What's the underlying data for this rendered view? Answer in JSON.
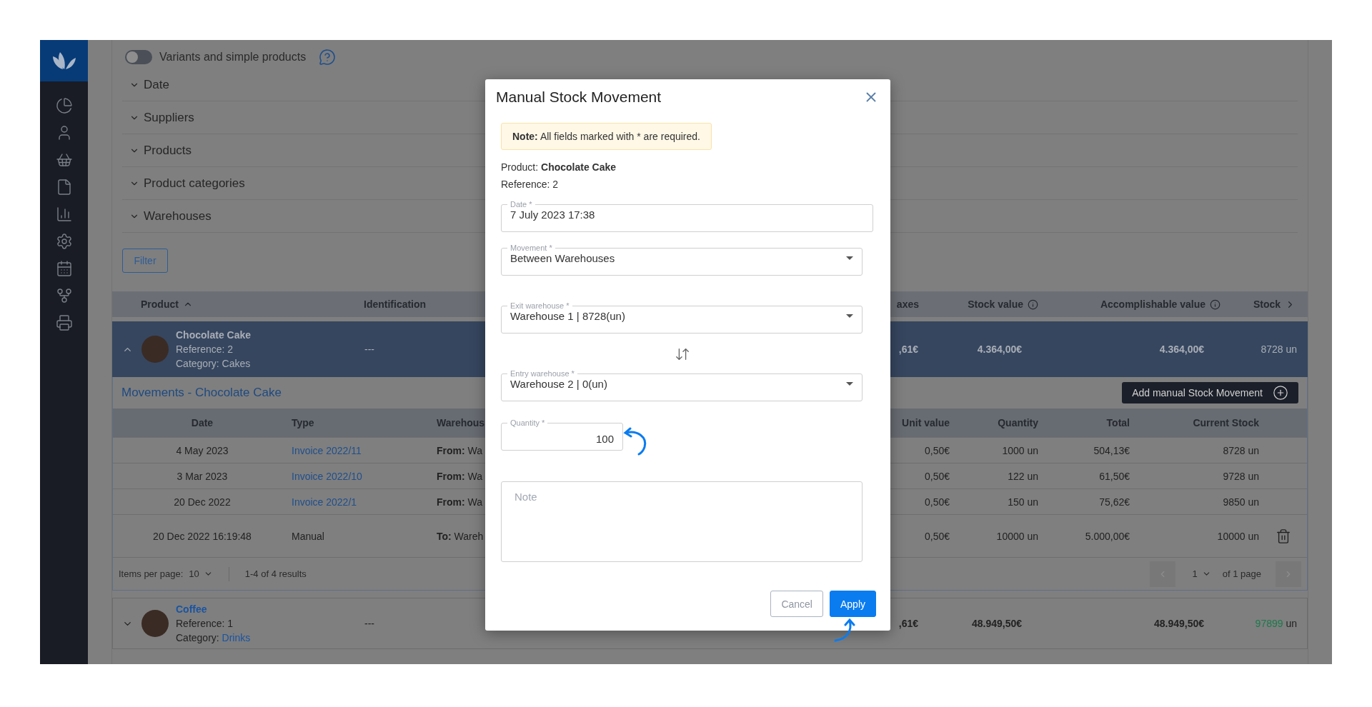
{
  "filters": {
    "toggle": {
      "label": "Variants and simple products",
      "on": false
    },
    "sections": [
      {
        "label": "Date",
        "expanded": false
      },
      {
        "label": "Suppliers",
        "expanded": false
      },
      {
        "label": "Products",
        "expanded": false
      },
      {
        "label": "Product categories",
        "expanded": false
      },
      {
        "label": "Warehouses",
        "expanded": false
      }
    ],
    "filter_button": "Filter"
  },
  "products_table": {
    "columns": [
      {
        "label": "Product",
        "kind": "sort"
      },
      {
        "label": "Identification",
        "kind": "plain"
      },
      {
        "label": "axes",
        "kind": "plain"
      },
      {
        "label": "Stock value",
        "kind": "info"
      },
      {
        "label": "Accomplishable value",
        "kind": "info"
      },
      {
        "label": "Stock",
        "kind": "next"
      }
    ],
    "rows": [
      {
        "name": "Chocolate Cake",
        "reference": "Reference: 2",
        "category_label": "Category:",
        "category": "Cakes",
        "identification": "---",
        "taxes": ",61€",
        "stock_value": "4.364,00€",
        "accomplishable_value": "4.364,00€",
        "stock": "8728",
        "stock_unit": "un",
        "expanded": true
      },
      {
        "name": "Coffee",
        "reference": "Reference: 1",
        "category_label": "Category:",
        "category": "Drinks",
        "identification": "---",
        "taxes": ",61€",
        "stock_value": "48.949,50€",
        "accomplishable_value": "48.949,50€",
        "stock": "97899",
        "stock_unit": "un",
        "expanded": false
      }
    ]
  },
  "movements": {
    "title": "Movements - Chocolate Cake",
    "add_button": "Add manual Stock Movement",
    "columns": [
      "Date",
      "Type",
      "Warehous",
      "Unit value",
      "Quantity",
      "Total",
      "Current Stock"
    ],
    "rows": [
      {
        "date": "4 May 2023",
        "type": "Invoice 2022/11",
        "link": true,
        "warehouse": "**From:** Wa",
        "unit_value": "0,50€",
        "quantity": "1000 un",
        "total": "504,13€",
        "current_stock": "8728 un",
        "deletable": false
      },
      {
        "date": "3 Mar 2023",
        "type": "Invoice 2022/10",
        "link": true,
        "warehouse": "**From:** Wa",
        "unit_value": "0,50€",
        "quantity": "122 un",
        "total": "61,50€",
        "current_stock": "9728 un",
        "deletable": false
      },
      {
        "date": "20 Dec 2022",
        "type": "Invoice 2022/1",
        "link": true,
        "warehouse": "**From:** Wa",
        "unit_value": "0,50€",
        "quantity": "150 un",
        "total": "75,62€",
        "current_stock": "9850 un",
        "deletable": false
      },
      {
        "date": "20 Dec 2022 16:19:48",
        "type": "Manual",
        "link": false,
        "warehouse": "**To:** Wareh",
        "unit_value": "0,50€",
        "quantity": "10000 un",
        "total": "5.000,00€",
        "current_stock": "10000 un",
        "deletable": true
      }
    ],
    "pagination": {
      "items_label": "Items per page:",
      "items_value": "10",
      "results": "1-4 of 4 results",
      "page": "1",
      "page_total": "of 1 page"
    }
  },
  "modal": {
    "title": "Manual Stock Movement",
    "note": "**Note:** All fields marked with * are required.",
    "product": "Product: **Chocolate Cake**",
    "reference": "Reference: 2",
    "fields": [
      {
        "kind": "text",
        "label": "Date *",
        "value": "7 July 2023 17:38"
      },
      {
        "kind": "select",
        "label": "Movement *",
        "value": "Between Warehouses"
      },
      {
        "kind": "select",
        "label": "Exit warehouse *",
        "value": "Warehouse 1 | 8728(un)"
      },
      {
        "kind": "swap"
      },
      {
        "kind": "select",
        "label": "Entry warehouse *",
        "value": "Warehouse 2 | 0(un)"
      },
      {
        "kind": "number",
        "label": "Quantity *",
        "value": "100"
      },
      {
        "kind": "textarea",
        "placeholder": "Note"
      }
    ],
    "buttons": [
      {
        "label": "Cancel",
        "kind": "secondary"
      },
      {
        "label": "Apply",
        "kind": "primary"
      }
    ]
  }
}
